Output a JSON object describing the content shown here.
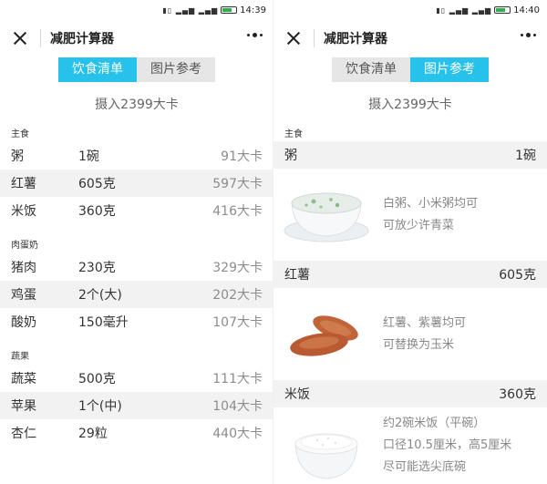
{
  "left": {
    "status_time": "14:39",
    "nav_title": "减肥计算器",
    "tabs": [
      "饮食清单",
      "图片参考"
    ],
    "active_tab": 0,
    "intake": "摄入2399大卡",
    "sections": [
      {
        "label": "主食",
        "items": [
          {
            "name": "粥",
            "amount": "1碗",
            "cal": "91大卡"
          },
          {
            "name": "红薯",
            "amount": "605克",
            "cal": "597大卡"
          },
          {
            "name": "米饭",
            "amount": "360克",
            "cal": "416大卡"
          }
        ]
      },
      {
        "label": "肉蛋奶",
        "items": [
          {
            "name": "猪肉",
            "amount": "230克",
            "cal": "329大卡"
          },
          {
            "name": "鸡蛋",
            "amount": "2个(大)",
            "cal": "202大卡"
          },
          {
            "name": "酸奶",
            "amount": "150毫升",
            "cal": "107大卡"
          }
        ]
      },
      {
        "label": "蔬果",
        "items": [
          {
            "name": "蔬菜",
            "amount": "500克",
            "cal": "111大卡"
          },
          {
            "name": "苹果",
            "amount": "1个(中)",
            "cal": "104大卡"
          },
          {
            "name": "杏仁",
            "amount": "29粒",
            "cal": "440大卡"
          }
        ]
      }
    ]
  },
  "right": {
    "status_time": "14:40",
    "nav_title": "减肥计算器",
    "tabs": [
      "饮食清单",
      "图片参考"
    ],
    "active_tab": 1,
    "intake": "摄入2399大卡",
    "section_label": "主食",
    "items": [
      {
        "name": "粥",
        "amount": "1碗",
        "desc": [
          "白粥、小米粥均可",
          "可放少许青菜"
        ],
        "icon": "porridge-bowl-icon"
      },
      {
        "name": "红薯",
        "amount": "605克",
        "desc": [
          "红薯、紫薯均可",
          "可替换为玉米"
        ],
        "icon": "sweet-potato-icon"
      },
      {
        "name": "米饭",
        "amount": "360克",
        "desc": [
          "约2碗米饭（平碗）",
          "口径10.5厘米，高5厘米",
          "尽可能选尖底碗"
        ],
        "icon": "rice-bowl-icon"
      }
    ]
  },
  "colors": {
    "accent": "#27c2ec",
    "row_alt": "#f2f2f2",
    "battery": "#2bb24c"
  }
}
